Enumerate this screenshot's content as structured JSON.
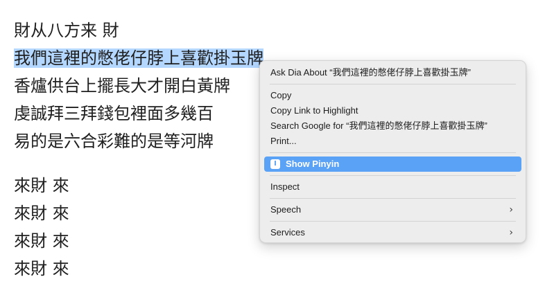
{
  "lyrics": {
    "line1": "財从八方来 財",
    "line2": "我們這裡的憋佬仔脖上喜歡掛玉牌",
    "line3": "香爐供台上擺長大才開白黃牌",
    "line4": "虔誠拜三拜錢包裡面多幾百",
    "line5": "易的是六合彩難的是等河牌",
    "line6": "來財 來",
    "line7": "來財 來",
    "line8": "來財 來",
    "line9": "來財 來"
  },
  "context_menu": {
    "ask_dia": "Ask Dia About “我們這裡的憋佬仔脖上喜歡掛玉牌”",
    "copy": "Copy",
    "copy_link": "Copy Link to Highlight",
    "search_google": "Search Google for “我們這裡的憋佬仔脖上喜歡掛玉牌”",
    "print": "Print...",
    "show_pinyin": "Show Pinyin",
    "inspect": "Inspect",
    "speech": "Speech",
    "services": "Services",
    "highlight_color": "#5aa2f6"
  },
  "icons": {
    "pinyin_icon": "I-cursor-icon",
    "submenu_chevron": "›"
  }
}
